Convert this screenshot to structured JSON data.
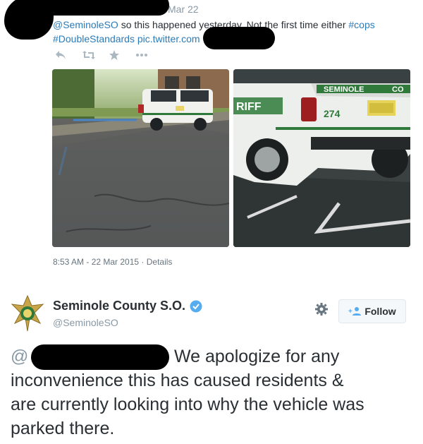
{
  "top_tweet": {
    "timestamp": "Mar 22",
    "text_line1_mention": "@SeminoleSO",
    "text_line1_body": " so this happened yesterday. Not the first time either ",
    "text_line1_hashtag": "#cops",
    "text_line2_hashtag": "#DoubleStandards",
    "text_line2_link": " pic.twitter.com",
    "actions": {
      "reply_icon": "reply-icon",
      "retweet_icon": "retweet-icon",
      "favorite_icon": "star-icon",
      "more_icon": "more-icon"
    },
    "photo_left_desc_color": "#5a5d5c",
    "photo_right_desc_color": "#343a3a",
    "vehicle_number": "274",
    "vehicle_text": "SEMINOLE",
    "vehicle_text_right": "CO",
    "vehicle_side_text": "RIFF",
    "meta": "8:53 AM - 22 Mar 2015 · Details"
  },
  "bottom_tweet": {
    "display_name": "Seminole County S.O.",
    "handle": "@SeminoleSO",
    "follow_label": "Follow",
    "mention_prefix": "@",
    "line1": "We apologize for any",
    "line2": "inconvenience this has caused residents &",
    "line3": "are currently looking into why the vehicle was",
    "line4": "parked there."
  },
  "colors": {
    "link": "#2b7bb9",
    "muted": "#8899a6",
    "text": "#292f33",
    "verified": "#55acee",
    "badge_gold": "#c9a54a"
  }
}
